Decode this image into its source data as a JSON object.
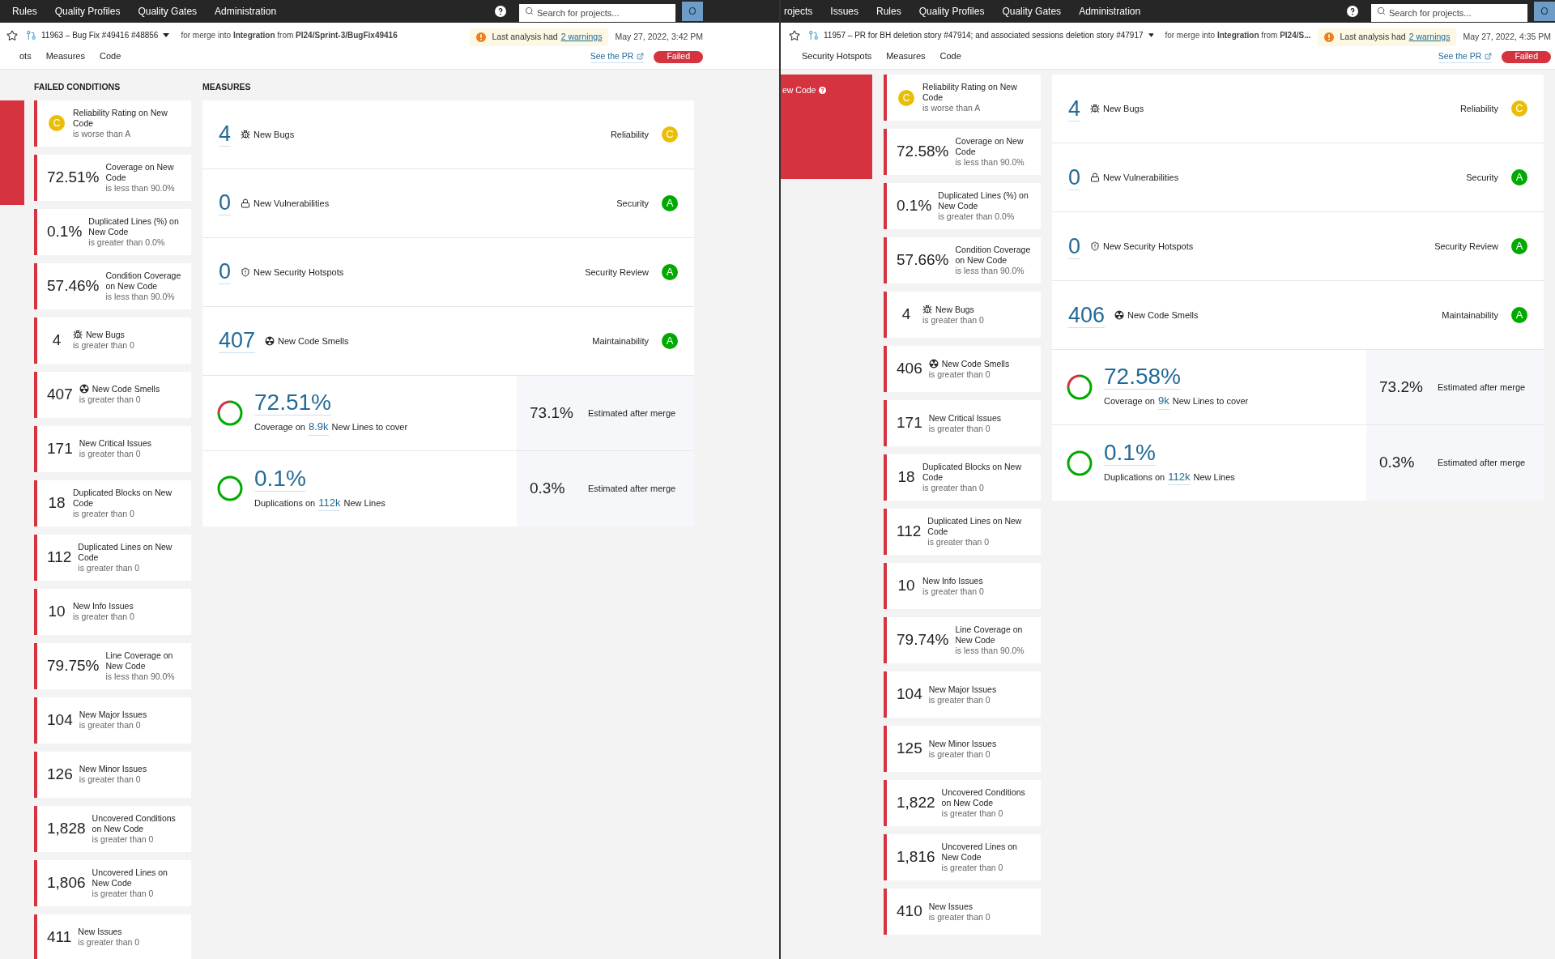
{
  "panes": [
    {
      "nav": [
        "Rules",
        "Quality Profiles",
        "Quality Gates",
        "Administration"
      ],
      "search": {
        "placeholder": "Search for projects..."
      },
      "avatar": "O",
      "title": "11963 – Bug Fix #49416 #48856",
      "merge": "for merge into **Integration** from **PI24/Sprint-3/BugFix49416**",
      "warning": {
        "text": "Last analysis had",
        "link": "2 warnings"
      },
      "date": "May 27, 2022, 3:42 PM",
      "see_pr": "See the PR",
      "status": "Failed",
      "tabs": [
        "ots",
        "Measures",
        "Code"
      ],
      "conditions_heading": "FAILED CONDITIONS",
      "measures_heading": "MEASURES",
      "conditions": [
        {
          "kind": "rating",
          "rating": "C",
          "color": "#eabe06",
          "label": "Reliability Rating on New Code",
          "threshold": "is worse than A"
        },
        {
          "kind": "value",
          "value": "72.51%",
          "label": "Coverage on New Code",
          "threshold": "is less than 90.0%"
        },
        {
          "kind": "value",
          "value": "0.1%",
          "label": "Duplicated Lines (%) on New Code",
          "threshold": "is greater than 0.0%"
        },
        {
          "kind": "value",
          "value": "57.46%",
          "label": "Condition Coverage on New Code",
          "threshold": "is less than 90.0%"
        },
        {
          "kind": "bugs",
          "value": "4",
          "label": "New Bugs",
          "threshold": "is greater than 0"
        },
        {
          "kind": "smells",
          "value": "407",
          "label": "New Code Smells",
          "threshold": "is greater than 0"
        },
        {
          "kind": "value",
          "value": "171",
          "label": "New Critical Issues",
          "threshold": "is greater than 0"
        },
        {
          "kind": "value",
          "value": "18",
          "label": "Duplicated Blocks on New Code",
          "threshold": "is greater than 0"
        },
        {
          "kind": "value",
          "value": "112",
          "label": "Duplicated Lines on New Code",
          "threshold": "is greater than 0"
        },
        {
          "kind": "value",
          "value": "10",
          "label": "New Info Issues",
          "threshold": "is greater than 0"
        },
        {
          "kind": "value",
          "value": "79.75%",
          "label": "Line Coverage on New Code",
          "threshold": "is less than 90.0%"
        },
        {
          "kind": "value",
          "value": "104",
          "label": "New Major Issues",
          "threshold": "is greater than 0"
        },
        {
          "kind": "value",
          "value": "126",
          "label": "New Minor Issues",
          "threshold": "is greater than 0"
        },
        {
          "kind": "value",
          "value": "1,828",
          "label": "Uncovered Conditions on New Code",
          "threshold": "is greater than 0"
        },
        {
          "kind": "value",
          "value": "1,806",
          "label": "Uncovered Lines on New Code",
          "threshold": "is greater than 0"
        },
        {
          "kind": "value",
          "value": "411",
          "label": "New Issues",
          "threshold": "is greater than 0"
        }
      ],
      "measures": [
        {
          "kind": "bugs",
          "value": "4",
          "label": "New Bugs",
          "domain": "Reliability",
          "rating": "C",
          "color": "#eabe06"
        },
        {
          "kind": "vulnerabilities",
          "value": "0",
          "label": "New Vulnerabilities",
          "domain": "Security",
          "rating": "A",
          "color": "#00aa00"
        },
        {
          "kind": "hotspots",
          "value": "0",
          "label": "New Security Hotspots",
          "domain": "Security Review",
          "rating": "A",
          "color": "#00aa00"
        },
        {
          "kind": "smells",
          "value": "407",
          "label": "New Code Smells",
          "domain": "Maintainability",
          "rating": "A",
          "color": "#00aa00"
        }
      ],
      "ratios": [
        {
          "kind": "coverage",
          "value": "72.51%",
          "prefix": "Coverage on",
          "link": "8.9k",
          "suffix": "New Lines to cover",
          "estimate": "73.1%",
          "estimate_label": "Estimated after merge"
        },
        {
          "kind": "duplications",
          "value": "0.1%",
          "prefix": "Duplications on",
          "link": "112k",
          "suffix": "New Lines",
          "estimate": "0.3%",
          "estimate_label": "Estimated after merge"
        }
      ]
    },
    {
      "nav": [
        "rojects",
        "Issues",
        "Rules",
        "Quality Profiles",
        "Quality Gates",
        "Administration"
      ],
      "search": {
        "placeholder": "Search for projects..."
      },
      "avatar": "O",
      "title": "11957 – PR for BH deletion story #47914; and associated sessions deletion story #47917",
      "merge": "for merge into **Integration** from **PI24/S...**",
      "warning": {
        "text": "Last analysis had",
        "link": "2 warnings"
      },
      "date": "May 27, 2022, 4:35 PM",
      "see_pr": "See the PR",
      "status": "Failed",
      "tabs": [
        "Security Hotspots",
        "Measures",
        "Code"
      ],
      "red_block_text": "ew Code",
      "conditions": [
        {
          "kind": "rating",
          "rating": "C",
          "color": "#eabe06",
          "label": "Reliability Rating on New Code",
          "threshold": "is worse than A"
        },
        {
          "kind": "value",
          "value": "72.58%",
          "label": "Coverage on New Code",
          "threshold": "is less than 90.0%"
        },
        {
          "kind": "value",
          "value": "0.1%",
          "label": "Duplicated Lines (%) on New Code",
          "threshold": "is greater than 0.0%"
        },
        {
          "kind": "value",
          "value": "57.66%",
          "label": "Condition Coverage on New Code",
          "threshold": "is less than 90.0%"
        },
        {
          "kind": "bugs",
          "value": "4",
          "label": "New Bugs",
          "threshold": "is greater than 0"
        },
        {
          "kind": "smells",
          "value": "406",
          "label": "New Code Smells",
          "threshold": "is greater than 0"
        },
        {
          "kind": "value",
          "value": "171",
          "label": "New Critical Issues",
          "threshold": "is greater than 0"
        },
        {
          "kind": "value",
          "value": "18",
          "label": "Duplicated Blocks on New Code",
          "threshold": "is greater than 0"
        },
        {
          "kind": "value",
          "value": "112",
          "label": "Duplicated Lines on New Code",
          "threshold": "is greater than 0"
        },
        {
          "kind": "value",
          "value": "10",
          "label": "New Info Issues",
          "threshold": "is greater than 0"
        },
        {
          "kind": "value",
          "value": "79.74%",
          "label": "Line Coverage on New Code",
          "threshold": "is less than 90.0%"
        },
        {
          "kind": "value",
          "value": "104",
          "label": "New Major Issues",
          "threshold": "is greater than 0"
        },
        {
          "kind": "value",
          "value": "125",
          "label": "New Minor Issues",
          "threshold": "is greater than 0"
        },
        {
          "kind": "value",
          "value": "1,822",
          "label": "Uncovered Conditions on New Code",
          "threshold": "is greater than 0"
        },
        {
          "kind": "value",
          "value": "1,816",
          "label": "Uncovered Lines on New Code",
          "threshold": "is greater than 0"
        },
        {
          "kind": "value",
          "value": "410",
          "label": "New Issues",
          "threshold": "is greater than 0"
        }
      ],
      "measures": [
        {
          "kind": "bugs",
          "value": "4",
          "label": "New Bugs",
          "domain": "Reliability",
          "rating": "C",
          "color": "#eabe06"
        },
        {
          "kind": "vulnerabilities",
          "value": "0",
          "label": "New Vulnerabilities",
          "domain": "Security",
          "rating": "A",
          "color": "#00aa00"
        },
        {
          "kind": "hotspots",
          "value": "0",
          "label": "New Security Hotspots",
          "domain": "Security Review",
          "rating": "A",
          "color": "#00aa00"
        },
        {
          "kind": "smells",
          "value": "406",
          "label": "New Code Smells",
          "domain": "Maintainability",
          "rating": "A",
          "color": "#00aa00"
        }
      ],
      "ratios": [
        {
          "kind": "coverage",
          "value": "72.58%",
          "prefix": "Coverage on",
          "link": "9k",
          "suffix": "New Lines to cover",
          "estimate": "73.2%",
          "estimate_label": "Estimated after merge"
        },
        {
          "kind": "duplications",
          "value": "0.1%",
          "prefix": "Duplications on",
          "link": "112k",
          "suffix": "New Lines",
          "estimate": "0.3%",
          "estimate_label": "Estimated after merge"
        }
      ]
    }
  ]
}
